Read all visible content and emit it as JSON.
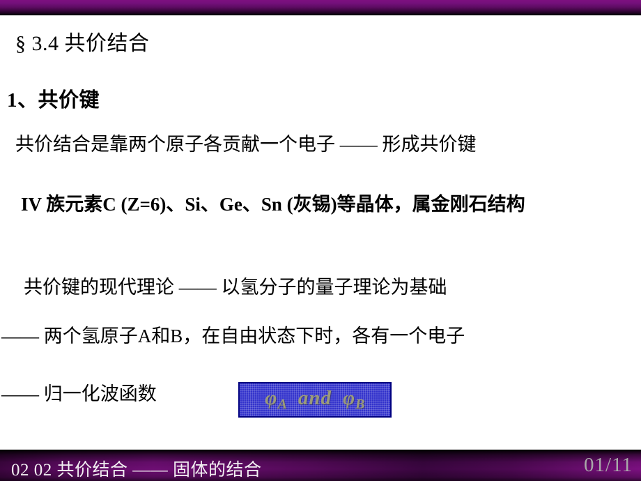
{
  "slide": {
    "title": "§ 3.4 共价结合",
    "heading": "1、共价键",
    "paragraphs": {
      "p1": "共价结合是靠两个原子各贡献一个电子 —— 形成共价键",
      "p2": "IV 族元素C (Z=6)、Si、Ge、Sn (灰锡)等晶体，属金刚石结构",
      "p3": "共价键的现代理论 —— 以氢分子的量子理论为基础",
      "p4": "—— 两个氢原子A和B，在自由状态下时，各有一个电子",
      "p5": "—— 归一化波函数"
    },
    "formula_box": {
      "phi_a": "φ",
      "sub_a": "A",
      "conjunction": "and",
      "phi_b": "φ",
      "sub_b": "B",
      "fill_color": "#3333CC",
      "border_color": "#000080",
      "text_color": "#9A9A7A"
    },
    "footer": {
      "left": "02  02  共价结合 —— 固体的结合",
      "page": "01/11",
      "bar_color": "#6E0E74",
      "text_color": "#F2EFF2",
      "page_color": "#A9A9A9"
    },
    "banner": {
      "top_color": "#7D1080",
      "bottom_color": "#000000"
    }
  }
}
